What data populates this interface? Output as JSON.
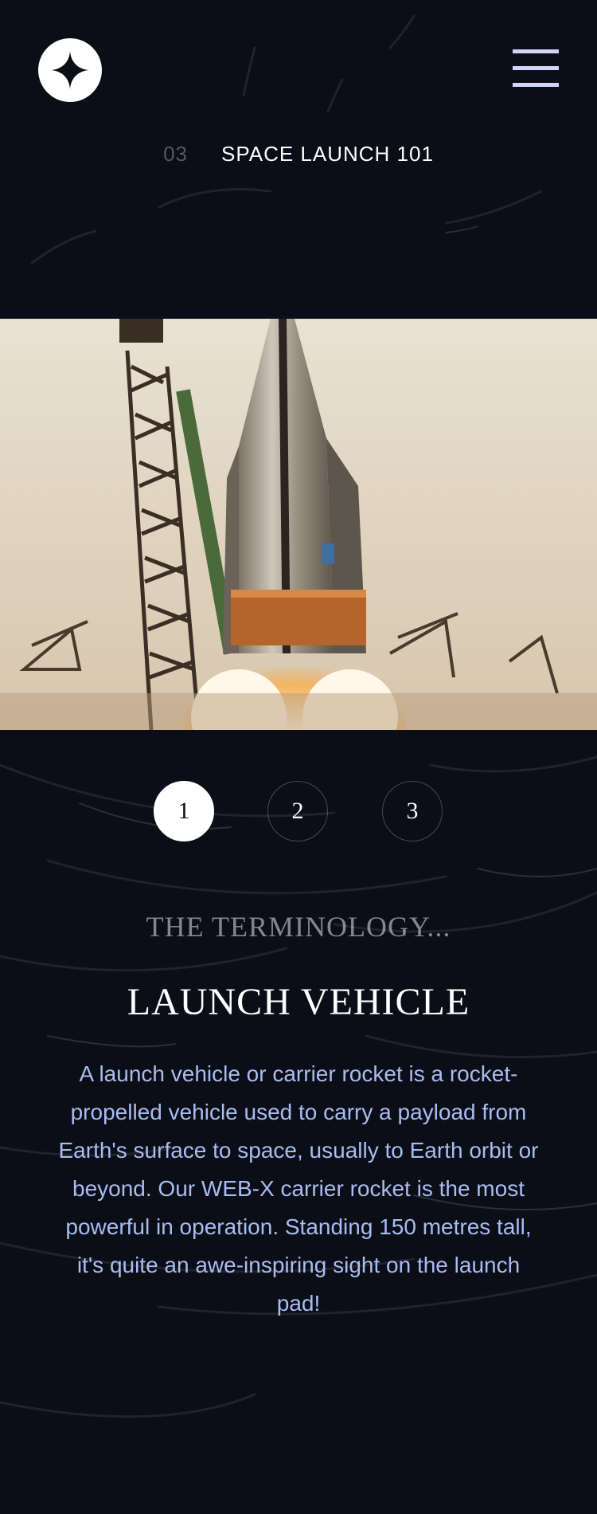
{
  "header": {
    "logo_icon": "star-logo-icon",
    "menu_icon": "hamburger-menu-icon"
  },
  "page": {
    "section_number": "03",
    "section_title": "SPACE LAUNCH 101"
  },
  "hero": {
    "image_subject": "rocket-launch-image"
  },
  "pager": {
    "items": [
      {
        "label": "1",
        "active": true
      },
      {
        "label": "2",
        "active": false
      },
      {
        "label": "3",
        "active": false
      }
    ]
  },
  "content": {
    "eyebrow": "The terminology...",
    "title": "Launch vehicle",
    "description": "A launch vehicle or carrier rocket is a rocket-propelled vehicle used to carry a payload from Earth's surface to space, usually to Earth orbit or beyond. Our WEB-X carrier rocket is the most powerful in operation. Standing 150 metres tall, it's quite an awe-inspiring sight on the launch pad!"
  },
  "colors": {
    "background": "#0b0d17",
    "accent_text": "#a9bdf0",
    "menu": "#d0d6f9",
    "white": "#ffffff"
  }
}
